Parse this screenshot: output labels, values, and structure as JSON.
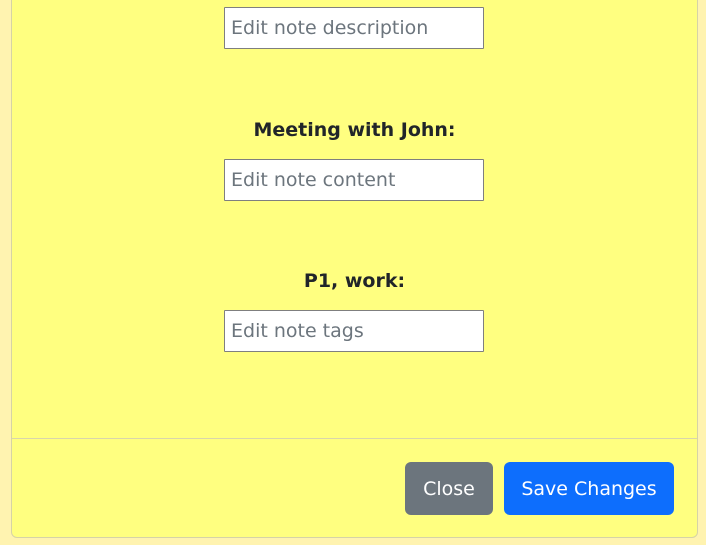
{
  "form": {
    "description": {
      "placeholder": "Edit note description",
      "value": ""
    },
    "content": {
      "label": "Meeting with John:",
      "placeholder": "Edit note content",
      "value": ""
    },
    "tags": {
      "label": "P1, work:",
      "placeholder": "Edit note tags",
      "value": ""
    }
  },
  "footer": {
    "close_label": "Close",
    "save_label": "Save Changes"
  },
  "colors": {
    "background": "#fff3b0",
    "modal": "#ffff80",
    "close_button": "#6c757d",
    "save_button": "#0d6efd"
  }
}
